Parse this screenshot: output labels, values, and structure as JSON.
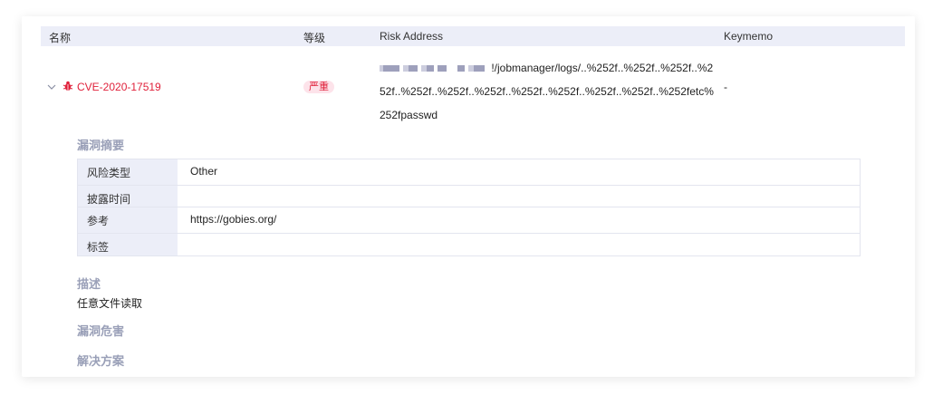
{
  "table": {
    "headers": {
      "name": "名称",
      "level": "等级",
      "risk_address": "Risk Address",
      "keymemo": "Keymemo"
    },
    "row": {
      "cve": "CVE-2020-17519",
      "severity": "严重",
      "address_visible": "!/jobmanager/logs/..%252f..%252f..%252f..%252f..%252f..%252f..%252f..%252f..%252f..%252f..%252f..%252fetc%252fpasswd",
      "keymemo": "-"
    }
  },
  "details": {
    "summary_title": "漏洞摘要",
    "rows": [
      {
        "label": "风险类型",
        "value": "Other"
      },
      {
        "label": "披露时间",
        "value": ""
      },
      {
        "label": "参考",
        "value": "https://gobies.org/"
      },
      {
        "label": "标签",
        "value": ""
      }
    ],
    "description_title": "描述",
    "description_text": "任意文件读取",
    "harm_title": "漏洞危害",
    "solution_title": "解决方案"
  },
  "colors": {
    "accent_red": "#e0213b",
    "header_bg": "#eceef8",
    "section_title": "#9aa0b8"
  }
}
